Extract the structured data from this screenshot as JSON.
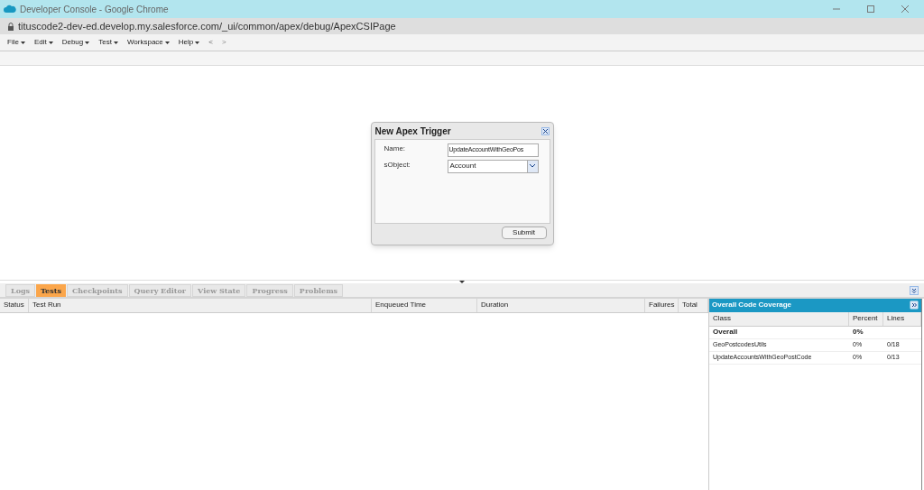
{
  "window": {
    "title": "Developer Console - Google Chrome"
  },
  "address_bar": {
    "url": "tituscode2-dev-ed.develop.my.salesforce.com/_ui/common/apex/debug/ApexCSIPage"
  },
  "menu": [
    {
      "label": "File"
    },
    {
      "label": "Edit"
    },
    {
      "label": "Debug"
    },
    {
      "label": "Test"
    },
    {
      "label": "Workspace"
    },
    {
      "label": "Help"
    }
  ],
  "nav": {
    "back": "<",
    "forward": ">"
  },
  "dialog": {
    "title": "New Apex Trigger",
    "fields": [
      {
        "kind": "text",
        "label": "Name:",
        "value": "UpdateAccountWithGeoPos"
      },
      {
        "kind": "select",
        "label": "sObject:",
        "value": "Account"
      }
    ],
    "submit": "Submit"
  },
  "tabs": [
    {
      "label": "Logs",
      "selected": false
    },
    {
      "label": "Tests",
      "selected": true
    },
    {
      "label": "Checkpoints",
      "selected": false
    },
    {
      "label": "Query Editor",
      "selected": false
    },
    {
      "label": "View State",
      "selected": false
    },
    {
      "label": "Progress",
      "selected": false
    },
    {
      "label": "Problems",
      "selected": false
    }
  ],
  "tests_table": {
    "columns": [
      "Status",
      "Test Run",
      "Enqueued Time",
      "Duration",
      "Failures",
      "Total"
    ]
  },
  "coverage": {
    "title": "Overall Code Coverage",
    "columns": [
      "Class",
      "Percent",
      "Lines"
    ],
    "rows": [
      {
        "kind": "total",
        "class": "Overall",
        "percent": "0%"
      },
      {
        "kind": "class",
        "class": "GeoPostcodesUtils",
        "percent": "0%",
        "lines": "0/18"
      },
      {
        "kind": "class",
        "class": "UpdateAccountsWithGeoPostCode",
        "percent": "0%",
        "lines": "0/13"
      }
    ]
  }
}
